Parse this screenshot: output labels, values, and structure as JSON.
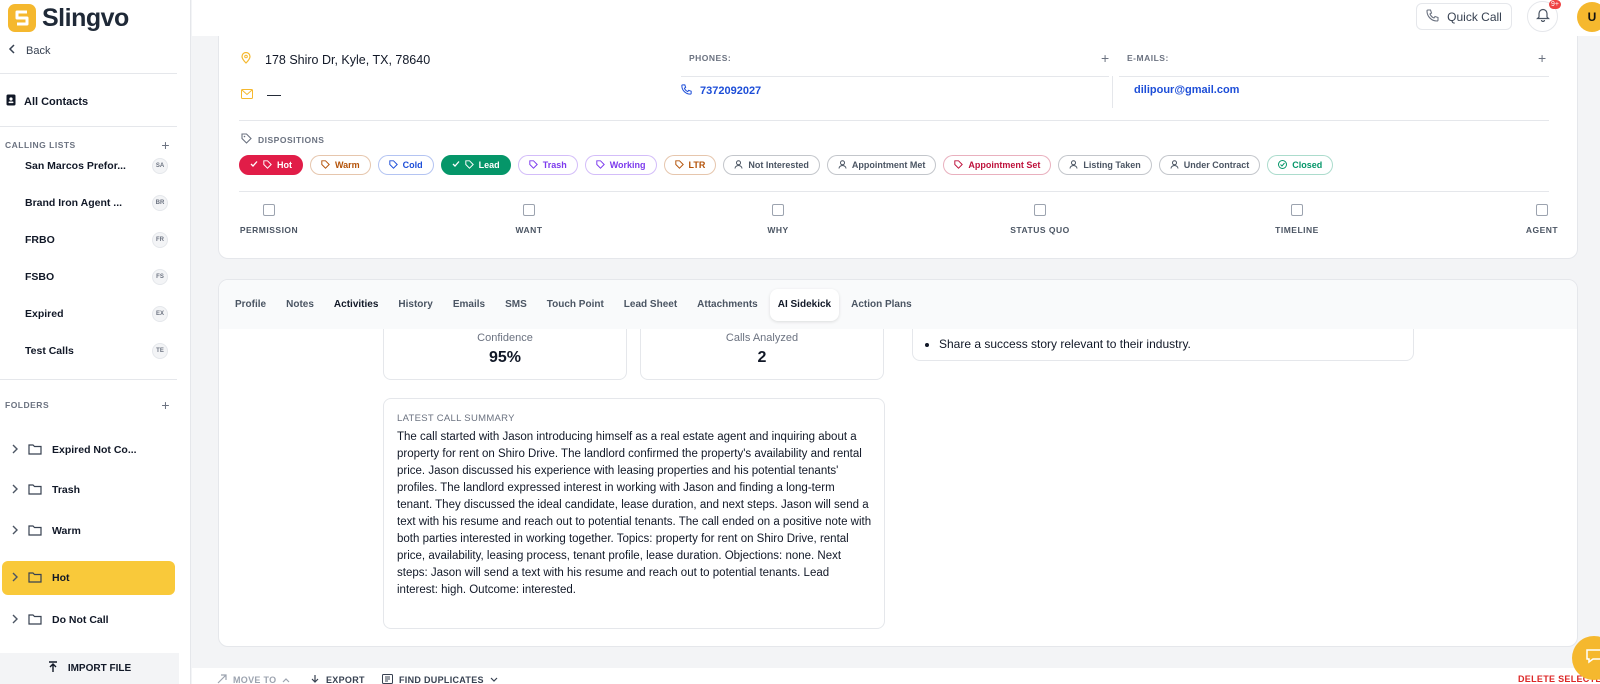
{
  "app": {
    "name": "Slingvo",
    "brand_color": "#f5b82e"
  },
  "sidebar": {
    "back_label": "Back",
    "all_contacts_label": "All Contacts",
    "calling_lists_title": "CALLING LISTS",
    "calling_lists": [
      {
        "label": "San Marcos Prefor...",
        "badge": "SA"
      },
      {
        "label": "Brand Iron Agent ...",
        "badge": "BR"
      },
      {
        "label": "FRBO",
        "badge": "FR"
      },
      {
        "label": "FSBO",
        "badge": "FS"
      },
      {
        "label": "Expired",
        "badge": "EX"
      },
      {
        "label": "Test Calls",
        "badge": "TE"
      }
    ],
    "folders_title": "FOLDERS",
    "folders": [
      {
        "label": "Expired Not Co..."
      },
      {
        "label": "Trash"
      },
      {
        "label": "Warm"
      },
      {
        "label": "Hot",
        "active": true
      },
      {
        "label": "Do Not Call"
      }
    ],
    "import_label": "IMPORT FILE"
  },
  "topbar": {
    "quick_call_label": "Quick Call",
    "notification_badge": "9+",
    "avatar_initial": "U"
  },
  "contact": {
    "address": "178 Shiro Dr, Kyle, TX, 78640",
    "email_placeholder": "—",
    "phones_label": "PHONES:",
    "phone": "7372092027",
    "emails_label": "E-MAILS:",
    "email": "dilipour@gmail.com"
  },
  "dispositions": {
    "title": "DISPOSITIONS",
    "chips": [
      {
        "label": "Hot",
        "selected": true,
        "color": "#e11d48"
      },
      {
        "label": "Warm",
        "color": "#b45309"
      },
      {
        "label": "Cold",
        "color": "#1d4ed8"
      },
      {
        "label": "Lead",
        "selected": true,
        "color": "#059669"
      },
      {
        "label": "Trash",
        "color": "#7c3aed"
      },
      {
        "label": "Working",
        "color": "#7c3aed"
      },
      {
        "label": "LTR",
        "color": "#b45309"
      },
      {
        "label": "Not Interested",
        "color": "#4b5563"
      },
      {
        "label": "Appointment Met",
        "color": "#4b5563"
      },
      {
        "label": "Appointment Set",
        "color": "#be123c"
      },
      {
        "label": "Listing Taken",
        "color": "#4b5563"
      },
      {
        "label": "Under Contract",
        "color": "#4b5563"
      },
      {
        "label": "Closed",
        "color": "#059669"
      }
    ]
  },
  "checklist": [
    "PERMISSION",
    "WANT",
    "WHY",
    "STATUS QUO",
    "TIMELINE",
    "AGENT"
  ],
  "tabs": [
    "Profile",
    "Notes",
    "Activities",
    "History",
    "Emails",
    "SMS",
    "Touch Point",
    "Lead Sheet",
    "Attachments",
    "AI Sidekick",
    "Action Plans"
  ],
  "active_tab": "AI Sidekick",
  "sidekick": {
    "confidence_label": "Confidence",
    "confidence_value": "95%",
    "calls_label": "Calls Analyzed",
    "calls_value": "2",
    "tip": "Share a success story relevant to their industry.",
    "summary_label": "LATEST CALL SUMMARY",
    "summary_text": "The call started with Jason introducing himself as a real estate agent and inquiring about a property for rent on Shiro Drive. The landlord confirmed the property's availability and rental price. Jason discussed his experience with leasing properties and his potential tenants' profiles. The landlord expressed interest in working with Jason and finding a long-term tenant. They discussed the ideal candidate, lease duration, and next steps. Jason will send a text with his resume and reach out to potential tenants. The call ended on a positive note with both parties interested in working together. Topics: property for rent on Shiro Drive, rental price, availability, leasing process, tenant profile, lease duration. Objections: none. Next steps: Jason will send a text with his resume and reach out to potential tenants. Lead interest: high. Outcome: interested."
  },
  "bottom_actions": {
    "move_to": "MOVE TO",
    "export": "EXPORT",
    "find_duplicates": "FIND DUPLICATES",
    "delete_selected": "DELETE SELECTE"
  }
}
